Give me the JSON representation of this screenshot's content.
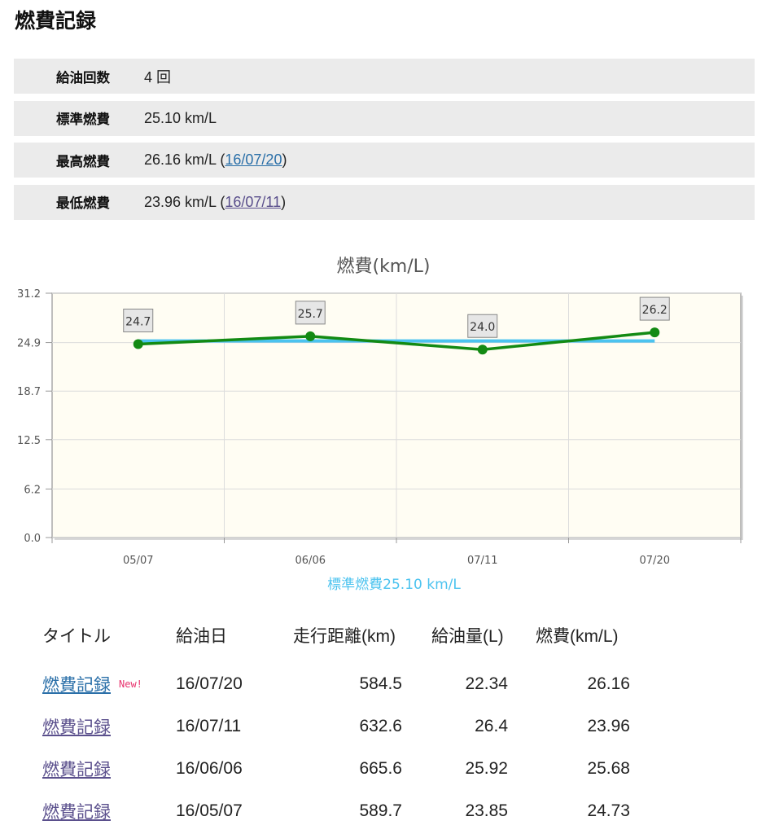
{
  "page": {
    "title": "燃費記録"
  },
  "summary": [
    {
      "label": "給油回数",
      "value": "4 回"
    },
    {
      "label": "標準燃費",
      "value": "25.10 km/L"
    },
    {
      "label": "最高燃費",
      "value": "26.16 km/L (",
      "link": "16/07/20",
      "suffix": ")"
    },
    {
      "label": "最低燃費",
      "value": "23.96 km/L (",
      "link": "16/07/11",
      "suffix": ")"
    }
  ],
  "colors": {
    "series": "#138a13",
    "average": "#4cc3ef",
    "plot_bg": "#fffdf3",
    "link": "#2a6fa8",
    "visited_link": "#5a4f8c",
    "new_badge": "#e8336e"
  },
  "chart_data": {
    "type": "line",
    "title": "燃費(km/L)",
    "categories": [
      "05/07",
      "06/06",
      "07/11",
      "07/20"
    ],
    "series": [
      {
        "values": [
          24.7,
          25.7,
          24.0,
          26.2
        ],
        "data_labels": [
          "24.7",
          "25.7",
          "24.0",
          "26.2"
        ]
      },
      {
        "name": "標準燃費25.10 km/L",
        "values": [
          25.1,
          25.1,
          25.1,
          25.1
        ]
      }
    ],
    "yticks": [
      "31.2",
      "24.9",
      "18.7",
      "12.5",
      "6.2",
      "0.0"
    ],
    "ylim": [
      0,
      31.2
    ],
    "grid": true,
    "legend": "bottom"
  },
  "table": {
    "headers": {
      "title": "タイトル",
      "date": "給油日",
      "distance": "走行距離(km)",
      "fuel": "給油量(L)",
      "economy": "燃費(km/L)"
    },
    "rows": [
      {
        "title": "燃費記録",
        "badge": "New!",
        "date": "16/07/20",
        "distance": "584.5",
        "fuel": "22.34",
        "economy": "26.16"
      },
      {
        "title": "燃費記録",
        "date": "16/07/11",
        "distance": "632.6",
        "fuel": "26.4",
        "economy": "23.96"
      },
      {
        "title": "燃費記録",
        "date": "16/06/06",
        "distance": "665.6",
        "fuel": "25.92",
        "economy": "25.68"
      },
      {
        "title": "燃費記録",
        "date": "16/05/07",
        "distance": "589.7",
        "fuel": "23.85",
        "economy": "24.73"
      }
    ]
  }
}
